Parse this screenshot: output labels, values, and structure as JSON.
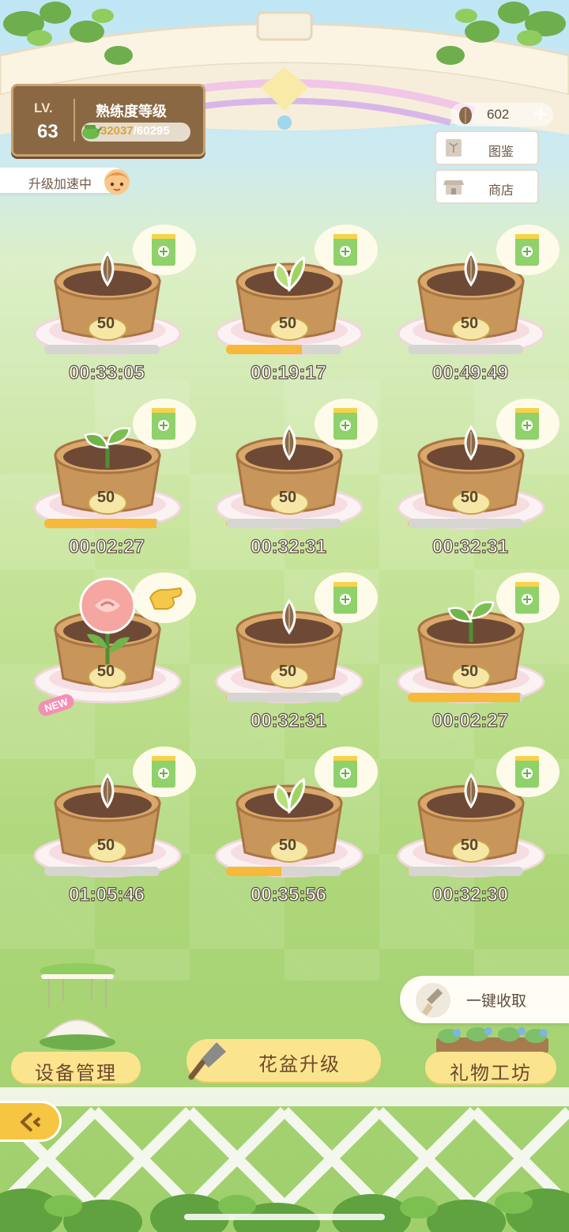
{
  "level": {
    "label": "LV.",
    "value": "63",
    "mastery_title": "熟练度等级",
    "xp_current": "32037",
    "xp_separator": "/",
    "xp_max": "60295",
    "progress_fraction": 0.531
  },
  "speedup_label": "升级加速中",
  "currency": {
    "amount": "602",
    "plus": "+"
  },
  "side_buttons": {
    "catalog": "图鉴",
    "shop": "商店"
  },
  "pots": [
    {
      "number": "50",
      "timer": "00:33:05",
      "progress": 0.0,
      "plant": "seed"
    },
    {
      "number": "50",
      "timer": "00:19:17",
      "progress": 0.66,
      "plant": "leaf"
    },
    {
      "number": "50",
      "timer": "00:49:49",
      "progress": 0.0,
      "plant": "seed"
    },
    {
      "number": "50",
      "timer": "00:02:27",
      "progress": 0.97,
      "plant": "sprout"
    },
    {
      "number": "50",
      "timer": "00:32:31",
      "progress": 0.01,
      "plant": "seed"
    },
    {
      "number": "50",
      "timer": "00:32:31",
      "progress": 0.01,
      "plant": "seed"
    },
    {
      "number": "50",
      "timer": "",
      "progress": null,
      "plant": "rose",
      "new": "NEW"
    },
    {
      "number": "50",
      "timer": "00:32:31",
      "progress": 0.01,
      "plant": "seed"
    },
    {
      "number": "50",
      "timer": "00:02:27",
      "progress": 0.97,
      "plant": "sprout"
    },
    {
      "number": "50",
      "timer": "01:05:46",
      "progress": 0.0,
      "plant": "seed"
    },
    {
      "number": "50",
      "timer": "00:35:56",
      "progress": 0.48,
      "plant": "leaf"
    },
    {
      "number": "50",
      "timer": "00:32:30",
      "progress": 0.01,
      "plant": "seed"
    }
  ],
  "bottom": {
    "equipment": "设备管理",
    "pot_upgrade": "花盆升级",
    "gift_workshop": "礼物工坊",
    "one_click_harvest": "一键收取"
  },
  "colors": {
    "progress_fill": "#f6b93b",
    "pot_wood": "#c8955a",
    "button_yellow": "#fbe48e"
  }
}
